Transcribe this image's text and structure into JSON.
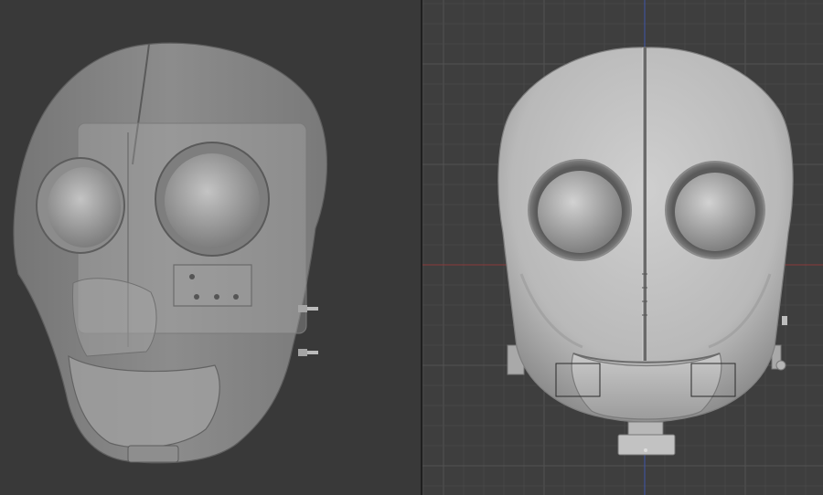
{
  "app": {
    "colors": {
      "viewport_background_left": "#393939",
      "viewport_background_right": "#3e3e3e",
      "divider": "#1f1f1f",
      "grid_minor": "#474747",
      "grid_major": "#525252",
      "x_axis": "#8a3a3a",
      "z_axis": "#3f55a8",
      "mesh_light": "#c8c8c8",
      "mesh_mid": "#a3a3a3",
      "mesh_shadow": "#6e6e6e",
      "xray_mesh": "#9a9a9a"
    },
    "viewports": [
      {
        "name": "perspective-xray-viewport",
        "shading": "x-ray",
        "view": "perspective"
      },
      {
        "name": "front-ortho-viewport",
        "shading": "solid",
        "view": "front-orthographic",
        "grid": true,
        "axes": [
          "x",
          "z"
        ]
      }
    ],
    "objects": [
      "robot-head-mesh"
    ]
  }
}
